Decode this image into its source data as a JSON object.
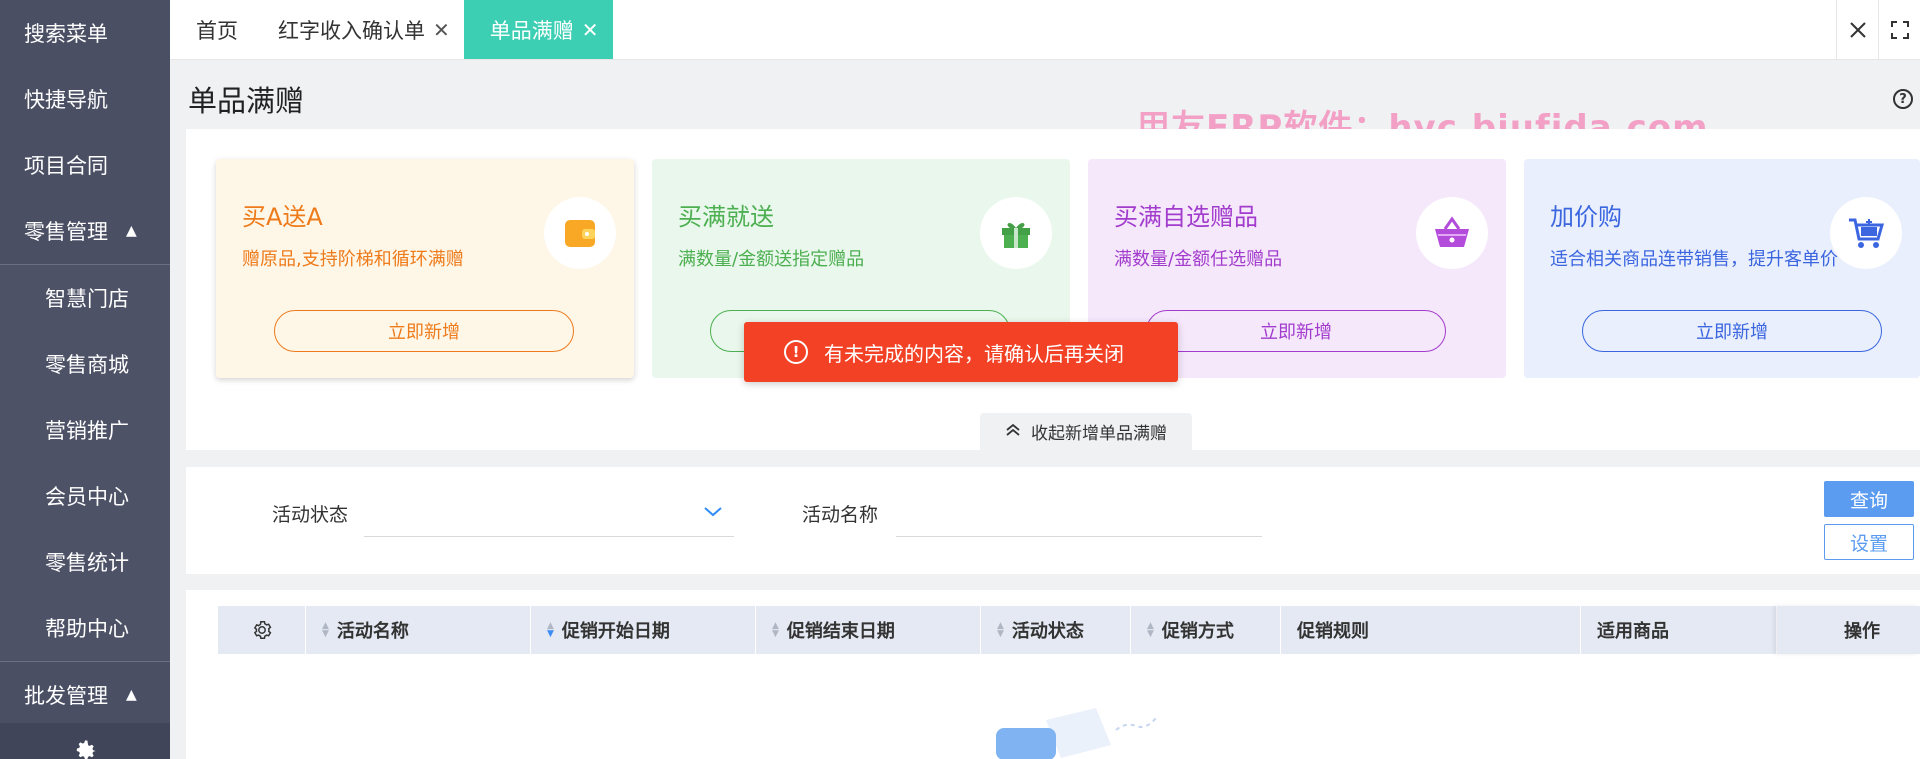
{
  "sidebar": {
    "items": [
      {
        "label": "搜索菜单"
      },
      {
        "label": "快捷导航"
      },
      {
        "label": "项目合同"
      },
      {
        "label": "零售管理"
      },
      {
        "label": "智慧门店"
      },
      {
        "label": "零售商城"
      },
      {
        "label": "营销推广"
      },
      {
        "label": "会员中心"
      },
      {
        "label": "零售统计"
      },
      {
        "label": "帮助中心"
      },
      {
        "label": "批发管理"
      }
    ],
    "expand_caret": "▲"
  },
  "tabs": [
    {
      "label": "首页"
    },
    {
      "label": "红字收入确认单",
      "close": "✕"
    },
    {
      "label": "单品满赠",
      "close": "✕",
      "active": true
    }
  ],
  "page": {
    "title": "单品满赠",
    "help": "?",
    "watermark": "用友ERP软件：hyc.bjufida.com"
  },
  "cards": [
    {
      "title": "买A送A",
      "desc": "赠原品,支持阶梯和循环满赠",
      "button": "立即新增",
      "icon": "wallet-icon"
    },
    {
      "title": "买满就送",
      "desc": "满数量/金额送指定赠品",
      "button": "立即新增",
      "icon": "gift-icon"
    },
    {
      "title": "买满自选赠品",
      "desc": "满数量/金额任选赠品",
      "button": "立即新增",
      "icon": "basket-icon"
    },
    {
      "title": "加价购",
      "desc": "适合相关商品连带销售，提升客单价",
      "button": "立即新增",
      "icon": "cart-icon"
    }
  ],
  "collapse_label": "收起新增单品满赠",
  "toast": {
    "icon": "!",
    "message": "有未完成的内容，请确认后再关闭",
    "color": "#f24125"
  },
  "filter": {
    "status_label": "活动状态",
    "name_label": "活动名称",
    "query_button": "查询",
    "settings_button": "设置"
  },
  "table": {
    "columns": [
      "活动名称",
      "促销开始日期",
      "促销结束日期",
      "活动状态",
      "促销方式",
      "促销规则",
      "适用商品",
      "操作"
    ]
  },
  "colors": {
    "sidebar": "#4a4f64",
    "active_tab": "#3ccfb4",
    "primary": "#5b9cf0"
  }
}
